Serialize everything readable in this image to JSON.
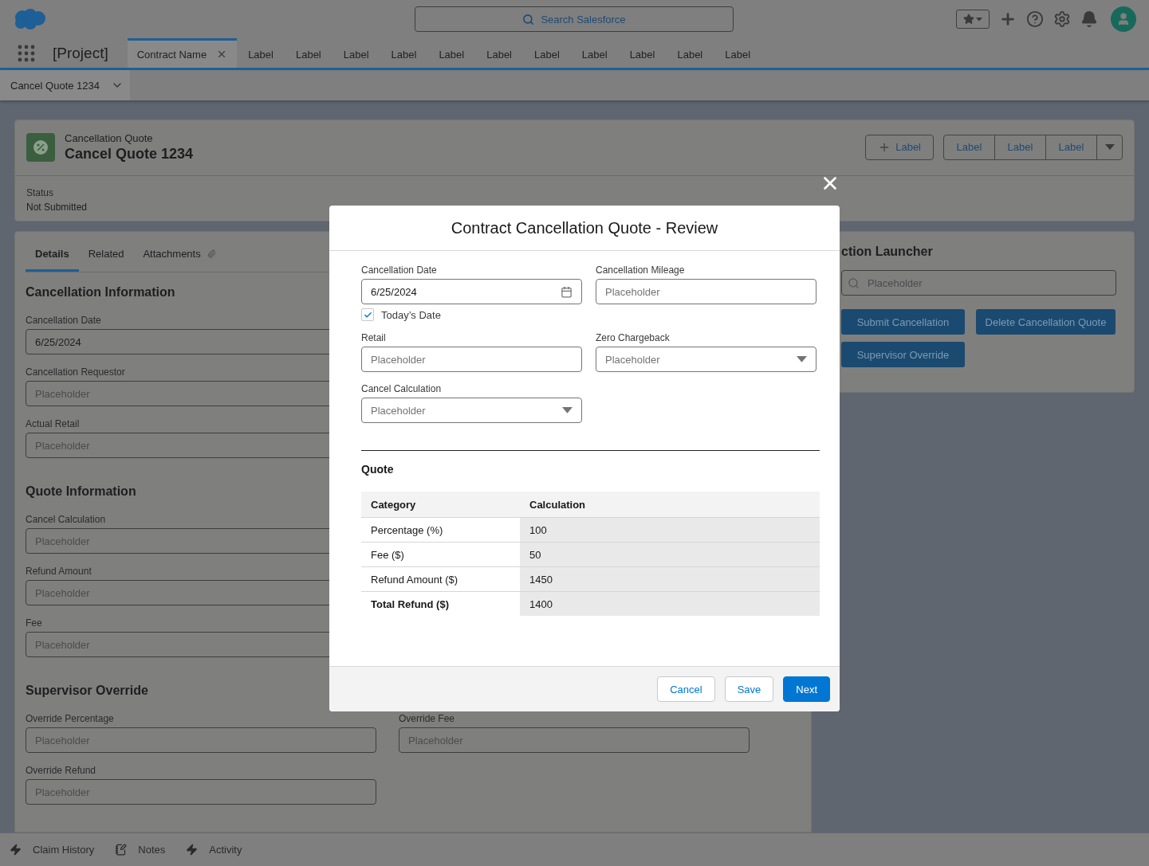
{
  "header": {
    "search_placeholder": "Search Salesforce"
  },
  "nav": {
    "app_name": "[Project]",
    "tabs": [
      {
        "label": "Contract Name",
        "selected": true,
        "closable": true
      },
      {
        "label": "Label",
        "selected": false,
        "closable": false
      },
      {
        "label": "Label",
        "selected": false,
        "closable": false
      },
      {
        "label": "Label",
        "selected": false,
        "closable": false
      },
      {
        "label": "Label",
        "selected": false,
        "closable": false
      },
      {
        "label": "Label",
        "selected": false,
        "closable": false
      },
      {
        "label": "Label",
        "selected": false,
        "closable": false
      },
      {
        "label": "Label",
        "selected": false,
        "closable": false
      },
      {
        "label": "Label",
        "selected": false,
        "closable": false
      },
      {
        "label": "Label",
        "selected": false,
        "closable": false
      },
      {
        "label": "Label",
        "selected": false,
        "closable": false
      },
      {
        "label": "Label",
        "selected": false,
        "closable": false
      }
    ]
  },
  "subtab": {
    "label": "Cancel Quote 1234"
  },
  "record": {
    "object_label": "Cancellation Quote",
    "title": "Cancel Quote 1234",
    "add_button": "Label",
    "button_group": [
      "Label",
      "Label",
      "Label"
    ],
    "fields": [
      {
        "label": "Status",
        "value": "Not Submitted"
      }
    ]
  },
  "details": {
    "tabs": [
      {
        "label": "Details",
        "selected": true,
        "kind": "plain"
      },
      {
        "label": "Related",
        "selected": false,
        "kind": "plain"
      },
      {
        "label": "Attachments",
        "selected": false,
        "kind": "attachment"
      }
    ],
    "sections": [
      {
        "title": "Cancellation Information",
        "rows": [
          [
            {
              "label": "Cancellation Date",
              "value": "6/25/2024"
            }
          ],
          [
            {
              "label": "Cancellation Requestor",
              "placeholder": "Placeholder"
            }
          ],
          [
            {
              "label": "Actual Retail",
              "placeholder": "Placeholder"
            }
          ]
        ]
      },
      {
        "title": "Quote Information",
        "rows": [
          [
            {
              "label": "Cancel Calculation",
              "placeholder": "Placeholder"
            }
          ],
          [
            {
              "label": "Refund Amount",
              "placeholder": "Placeholder"
            }
          ],
          [
            {
              "label": "Fee",
              "placeholder": "Placeholder"
            }
          ]
        ]
      },
      {
        "title": "Supervisor Override",
        "rows": [
          [
            {
              "label": "Override Percentage",
              "placeholder": "Placeholder"
            },
            {
              "label": "Override Fee",
              "placeholder": "Placeholder"
            }
          ],
          [
            {
              "label": "Override Refund",
              "placeholder": "Placeholder"
            }
          ]
        ]
      }
    ]
  },
  "action_launcher": {
    "title": "ction Launcher",
    "search_placeholder": "Placeholder",
    "actions": [
      "Submit Cancellation",
      "Delete Cancellation Quote",
      "Supervisor Override"
    ]
  },
  "utility_bar": [
    {
      "label": "Claim History",
      "kind": "bolt"
    },
    {
      "label": "Notes",
      "kind": "notes"
    },
    {
      "label": "Activity",
      "kind": "bolt"
    }
  ],
  "modal": {
    "title": "Contract Cancellation Quote - Review",
    "fields": [
      {
        "label": "Cancellation Date",
        "kind": "date",
        "value": "6/25/2024",
        "checkbox": {
          "label": "Today’s Date",
          "checked": true
        }
      },
      {
        "label": "Cancellation Mileage",
        "kind": "text",
        "placeholder": "Placeholder"
      },
      {
        "label": "Retail",
        "kind": "text",
        "placeholder": "Placeholder"
      },
      {
        "label": "Zero Chargeback",
        "kind": "select",
        "placeholder": "Placeholder"
      },
      {
        "label": "Cancel Calculation",
        "kind": "select",
        "placeholder": "Placeholder"
      }
    ],
    "section_title": "Quote",
    "table": {
      "columns": [
        "Category",
        "Calculation"
      ],
      "rows": [
        {
          "cells": [
            "Percentage (%)",
            "100"
          ],
          "bold": false
        },
        {
          "cells": [
            "Fee ($)",
            "50"
          ],
          "bold": false
        },
        {
          "cells": [
            "Refund Amount ($)",
            "1450"
          ],
          "bold": false
        },
        {
          "cells": [
            "Total Refund ($)",
            "1400"
          ],
          "bold": true
        }
      ]
    },
    "buttons": [
      {
        "label": "Cancel",
        "kind": "neutral"
      },
      {
        "label": "Save",
        "kind": "neutral"
      },
      {
        "label": "Next",
        "kind": "brand"
      }
    ]
  }
}
